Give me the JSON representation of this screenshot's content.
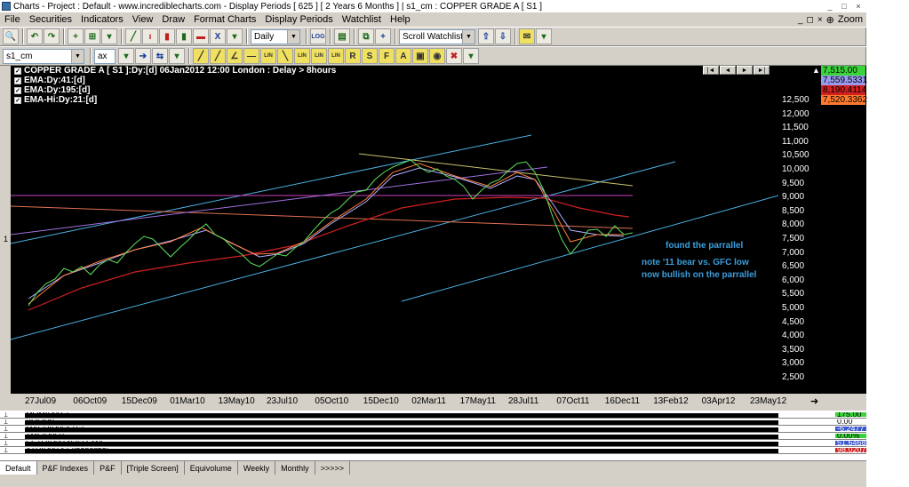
{
  "window": {
    "title": "Charts - Project : Default - www.incrediblecharts.com - Display Periods  [ 625 ]  [ 2 Years 6 Months ]  |  s1_cm :  COPPER GRADE A  [ S1 ]",
    "minimize": "_",
    "maximize": "□",
    "close": "×"
  },
  "menu": {
    "items": [
      "File",
      "Securities",
      "Indicators",
      "View",
      "Draw",
      "Format Charts",
      "Display Periods",
      "Watchlist",
      "Help"
    ],
    "zoom_label": "Zoom"
  },
  "toolbar": {
    "period": "Daily",
    "log_label": "LOG",
    "watchlist": "Scroll Watchlist"
  },
  "toolbar2": {
    "security": "s1_cm",
    "ax": "ax",
    "tools": [
      "LIN",
      "LIN",
      "LIN",
      "LIN",
      "R",
      "S",
      "F",
      "A"
    ]
  },
  "chart": {
    "header": "COPPER GRADE A  [ S1 ]:Dy:[d]   06Jan2012 12:00 London   : Delay > 8hours",
    "legend": [
      {
        "label": "EMA:Dy:41:[d]",
        "color": "#b0b0ff"
      },
      {
        "label": "EMA:Dy:195:[d]",
        "color": "#ff4040"
      },
      {
        "label": "EMA-Hi:Dy:21:[d]",
        "color": "#ff8040"
      }
    ],
    "nav": [
      "|◄",
      "◄",
      "►",
      "►|"
    ],
    "annotations": [
      "found the parrallel",
      "note '11 bear vs. GFC low",
      "now bullish on the parrallel"
    ],
    "y_ticks": [
      "12,500",
      "12,000",
      "11,500",
      "11,000",
      "10,500",
      "10,000",
      "9,500",
      "9,000",
      "8,500",
      "8,000",
      "7,500",
      "7,000",
      "6,500",
      "6,000",
      "5,500",
      "5,000",
      "4,500",
      "4,000",
      "3,500",
      "3,000",
      "2,500"
    ],
    "value_badges": [
      {
        "value": "7,515.00",
        "color": "#3ad43a"
      },
      {
        "value": "7,559.5331",
        "color": "#9a9af0"
      },
      {
        "value": "8,190.4114",
        "color": "#d02020"
      },
      {
        "value": "7,520.3362",
        "color": "#ff7a30"
      }
    ],
    "x_ticks": [
      "27Jul09",
      "06Oct09",
      "15Dec09",
      "01Mar10",
      "13May10",
      "23Jul10",
      "05Oct10",
      "15Dec10",
      "02Mar11",
      "17May11",
      "28Jul11",
      "07Oct11",
      "16Dec11",
      "13Feb12",
      "03Apr12",
      "23May12"
    ],
    "side_label": "1"
  },
  "indicators": [
    {
      "nums": "1",
      "label": "MOM:Dy:12",
      "value": "175.00",
      "color": "#3ad43a"
    },
    {
      "nums": "1",
      "label": "VOL:Dy",
      "value": "0.00",
      "color": "#ffffff"
    },
    {
      "nums": "1",
      "label": "MACD:Dy:26:12",
      "value": "-6.2477",
      "color": "#3a55d0"
    },
    {
      "nums": "1",
      "label": "TMF:Dy:21",
      "value": "0.00%",
      "color": "#3ad43a"
    },
    {
      "nums": "1",
      "label": "SSTO:Dy:14:3:3 SMA",
      "value": "51.6468",
      "color": "#3a55d0"
    },
    {
      "nums": "1",
      "label": "ATR:Dy:14 Exponential",
      "value": "98.0207",
      "color": "#d02020"
    }
  ],
  "tabs": [
    "Default",
    "P&F Indexes",
    "P&F",
    "[Triple Screen]",
    "Equivolume",
    "Weekly",
    "Monthly",
    ">>>>>"
  ]
}
